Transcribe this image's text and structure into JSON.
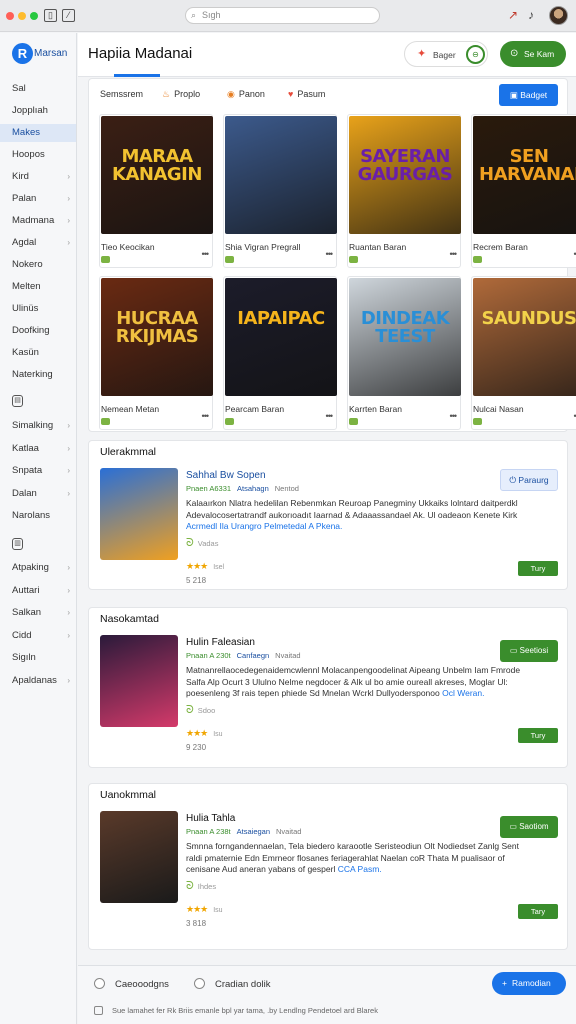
{
  "search": {
    "placeholder": "Sıgh"
  },
  "brand": {
    "logo": "R",
    "name": "Marsan"
  },
  "sidebar": {
    "items": [
      {
        "label": "Sal",
        "chev": false,
        "active": false
      },
      {
        "label": "Jopplıah",
        "chev": false,
        "active": false
      },
      {
        "label": "Makes",
        "chev": false,
        "active": true
      },
      {
        "label": "Hoopos",
        "chev": false,
        "active": false
      },
      {
        "label": "Kird",
        "chev": true,
        "active": false
      },
      {
        "label": "Palan",
        "chev": true,
        "active": false
      },
      {
        "label": "Madmana",
        "chev": true,
        "active": false
      },
      {
        "label": "Agdal",
        "chev": true,
        "active": false
      },
      {
        "label": "Nokero",
        "chev": false,
        "active": false
      },
      {
        "label": "Melten",
        "chev": false,
        "active": false
      },
      {
        "label": "Ulinüs",
        "chev": false,
        "active": false
      },
      {
        "label": "Doofking",
        "chev": false,
        "active": false
      },
      {
        "label": "Kasün",
        "chev": false,
        "active": false
      },
      {
        "label": "Naterking",
        "chev": false,
        "active": false
      }
    ],
    "items2": [
      {
        "label": "Simalking",
        "chev": true
      },
      {
        "label": "Katlaa",
        "chev": true
      },
      {
        "label": "Snpata",
        "chev": true
      },
      {
        "label": "Dalan",
        "chev": true
      },
      {
        "label": "Narolans",
        "chev": false
      }
    ],
    "items3": [
      {
        "label": "Atpaking",
        "chev": true
      },
      {
        "label": "Auttari",
        "chev": true
      },
      {
        "label": "Salkan",
        "chev": true
      },
      {
        "label": "Cidd",
        "chev": true
      },
      {
        "label": "Sigıln",
        "chev": false
      },
      {
        "label": "Apaldanas",
        "chev": true
      }
    ]
  },
  "header": {
    "title": "Hapiia Madanai",
    "pill_label": "Bager",
    "button_label": "Se Kam"
  },
  "filters": {
    "items": [
      {
        "label": "Semssrem",
        "icon": ""
      },
      {
        "label": "Proplo",
        "icon": "♨"
      },
      {
        "label": "Panon",
        "icon": "◉"
      },
      {
        "label": "Pasum",
        "icon": "♥"
      }
    ],
    "button_label": "Badget"
  },
  "tiles": [
    {
      "name": "Tieo Keocikan",
      "art": "MARAA KANAGIN",
      "bg": "#3b1f14",
      "fg": "#f2c230"
    },
    {
      "name": "Shia Vigran Pregrall",
      "art": "",
      "bg": "#3c5a8c",
      "fg": "#fff"
    },
    {
      "name": "Ruantan Baran",
      "art": "SAYERAN GAURGAS",
      "bg": "#e8a21a",
      "fg": "#6a1fa8"
    },
    {
      "name": "Recrem Baran",
      "art": "SEN HARVANAN",
      "bg": "#2a1a0c",
      "fg": "#f0a020"
    },
    {
      "name": "Nemean Metan",
      "art": "HUCRAA RKIJMAS",
      "bg": "#6a2a12",
      "fg": "#f0c040"
    },
    {
      "name": "Pearcam Baran",
      "art": "IAPAIPAC",
      "bg": "#1c1c2a",
      "fg": "#f5b41c"
    },
    {
      "name": "Karrten Baran",
      "art": "DINDEAK TEEST",
      "bg": "#cfd6dc",
      "fg": "#2a8fd6"
    },
    {
      "name": "Nulcai Nasan",
      "art": "SAUNDUS",
      "bg": "#b06a3a",
      "fg": "#f2d24a"
    }
  ],
  "sections": [
    {
      "heading": "Ulerakmmal",
      "title": "Sahhal Bw Sopen",
      "meta_hl": "Pnaen A6331",
      "meta_b": "Atsahagn",
      "meta_c": "Nentod",
      "desc": "Kalaaırkon Nlatra hedelilan Rebenmkan Reuroap Panegminy Ukkaiks lolntard daitperdkl Adevalocosertatrandf aukorıoadıt Iaarnad & Adaaassandael Ak. Ul oadeaon Kenete Kirk",
      "desc_link": "Acrmedl Ila Urangro Pelmetedal A Pkena.",
      "sub": "Vadas",
      "stars": "★★★",
      "rev": "Isel",
      "count": "5 218",
      "action": "Paraurg",
      "small": "Tury"
    },
    {
      "heading": "Nasokamtad",
      "title": "Hulin Faleasian",
      "meta_hl": "Pnaan A 230t",
      "meta_b": "Canfaegn",
      "meta_c": "Nvaitad",
      "desc": "Matnanrellaocedegenaidemcwlennl Molacanpengoodelinat Aipeang Unbelm Iam Fmrode Salfa Alp Ocurt 3 Ululno Nelme negdocer & Alk ul bo amie oureall akreses, Moglar Ul: poesenleng 3f rais tepen phiede Sd Mnelan Wcrkl Dullyodersponoo",
      "desc_link": "Ocl Weran.",
      "sub": "Sdoo",
      "stars": "★★★",
      "rev": "Isu",
      "count": "9 230",
      "action": "Seetiosi",
      "small": "Tury"
    },
    {
      "heading": "Uanokmmal",
      "title": "Hulia Tahla",
      "meta_hl": "Pnaan A 238t",
      "meta_b": "Atsaiegan",
      "meta_c": "Nvaitad",
      "desc": "Smnna forngandennaelan, Tela biedero karaootle Seristeodiun Olt Nodiedset Zanlg Sent raldi pmaternie Edn Emrneor flosanes feriagerahlat Naelan coR Thata M pualisaor of cenisane Aud aneran yabans of gesperl",
      "desc_link": "CCA Pasm.",
      "sub": "Ihdes",
      "stars": "★★★",
      "rev": "Isu",
      "count": "3 818",
      "action": "Saotiom",
      "small": "Tary"
    }
  ],
  "footer": {
    "opt1": "Caeooodgns",
    "opt2": "Cradian dolik",
    "fab": "Ramodian",
    "note": "Sue lamahet fer Rk Briis emanle bpl yar tama, .by Lendlng Pendetoel ard Blarek"
  },
  "colors": {
    "accent": "#1a73e8",
    "green": "#3a8d2c",
    "star": "#f0a500"
  }
}
